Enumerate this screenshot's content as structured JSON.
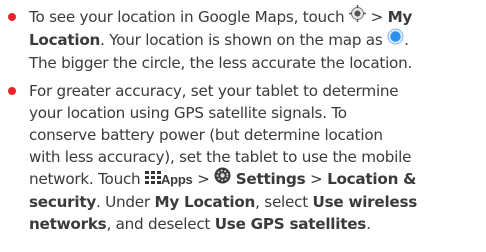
{
  "items": [
    {
      "line1_a": "To see your location in Google Maps, touch",
      "line1_sep": ">",
      "line1_b": "My",
      "line2_a": "Location",
      "line2_b": ". Your location is shown on the map as",
      "line2_c": ".",
      "line3": "The bigger the circle, the less accurate the location."
    },
    {
      "line1": "For greater accuracy, set your tablet to determine",
      "line2": "your location using GPS satellite signals. To",
      "line3": "conserve battery power (but determine location",
      "line4": "with less accuracy), set the tablet to use the mobile",
      "line5_a": "network. Touch",
      "line5_apps": "Apps",
      "line5_sep1": ">",
      "line5_settings": "Settings",
      "line5_sep2": ">",
      "line5_loc": "Location &",
      "line6_a": "security",
      "line6_b": ". Under",
      "line6_c": "My Location",
      "line6_d": ", select",
      "line6_e": "Use wireless",
      "line7_a": "networks",
      "line7_b": ", and deselect",
      "line7_c": "Use GPS satellites",
      "line7_d": "."
    }
  ],
  "icons": {
    "my_location": "my-location-icon",
    "location_dot": "location-dot-icon",
    "apps": "apps-grid-icon",
    "settings": "settings-icon"
  },
  "colors": {
    "bullet": "#e8242c",
    "text": "#3b3b3b",
    "location_dot": "#2b8ff0"
  }
}
